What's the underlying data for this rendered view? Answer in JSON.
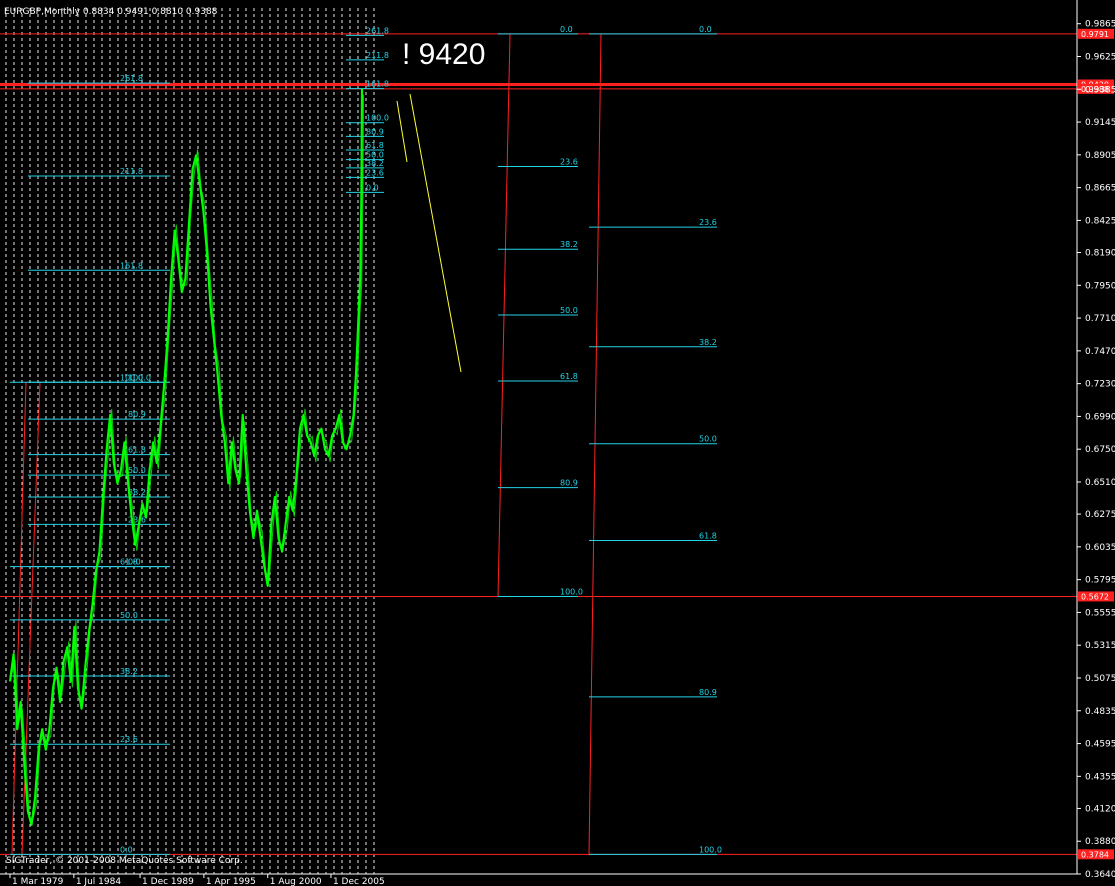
{
  "window": {
    "header": "EURGBP,Monthly  0.8834 0.9491 0.8810 0.9388",
    "copyright": "SIGTrader, © 2001-2008 MetaQuotes Software Corp.",
    "annotation": "! 9420"
  },
  "colors": {
    "background": "#000000",
    "price": "#00ff00",
    "fib": "#22d3e6",
    "level": "#ff2020",
    "trend": "#ffff33",
    "grid": "#ffffff"
  },
  "chart_data": {
    "type": "line",
    "symbol": "EURGBP",
    "timeframe": "Monthly",
    "ohlc_header": {
      "open": 0.8834,
      "high": 0.9491,
      "low": 0.881,
      "close": 0.9388
    },
    "ylim": [
      0.364,
      0.998
    ],
    "y_ticks": [
      "0.9865",
      "0.9625",
      "0.9385",
      "0.9145",
      "0.8905",
      "0.8665",
      "0.8425",
      "0.8190",
      "0.7950",
      "0.7710",
      "0.7470",
      "0.7230",
      "0.6990",
      "0.6750",
      "0.6510",
      "0.6275",
      "0.6035",
      "0.5795",
      "0.5555",
      "0.5315",
      "0.5075",
      "0.4835",
      "0.4595",
      "0.4355",
      "0.4120",
      "0.3880",
      "0.3640"
    ],
    "x_ticks": [
      "1 Mar 1979",
      "1 Jul 1984",
      "1 Dec 1989",
      "1 Apr 1995",
      "1 Aug 2000",
      "1 Dec 2005"
    ],
    "x_range_years": [
      1979.0,
      2008.5
    ],
    "price_path": [
      [
        1979.0,
        0.505
      ],
      [
        1979.3,
        0.525
      ],
      [
        1979.6,
        0.47
      ],
      [
        1979.9,
        0.49
      ],
      [
        1980.2,
        0.445
      ],
      [
        1980.5,
        0.41
      ],
      [
        1980.8,
        0.4
      ],
      [
        1981.1,
        0.42
      ],
      [
        1981.4,
        0.455
      ],
      [
        1981.7,
        0.47
      ],
      [
        1982.0,
        0.455
      ],
      [
        1982.3,
        0.47
      ],
      [
        1982.6,
        0.5
      ],
      [
        1982.9,
        0.515
      ],
      [
        1983.2,
        0.49
      ],
      [
        1983.5,
        0.52
      ],
      [
        1983.8,
        0.53
      ],
      [
        1984.1,
        0.505
      ],
      [
        1984.4,
        0.545
      ],
      [
        1984.7,
        0.5
      ],
      [
        1985.0,
        0.485
      ],
      [
        1985.3,
        0.515
      ],
      [
        1985.6,
        0.54
      ],
      [
        1985.9,
        0.56
      ],
      [
        1986.2,
        0.585
      ],
      [
        1986.5,
        0.6
      ],
      [
        1986.8,
        0.64
      ],
      [
        1987.1,
        0.675
      ],
      [
        1987.4,
        0.7
      ],
      [
        1987.7,
        0.665
      ],
      [
        1988.0,
        0.65
      ],
      [
        1988.3,
        0.66
      ],
      [
        1988.6,
        0.68
      ],
      [
        1988.9,
        0.65
      ],
      [
        1989.2,
        0.625
      ],
      [
        1989.5,
        0.605
      ],
      [
        1989.8,
        0.62
      ],
      [
        1990.1,
        0.635
      ],
      [
        1990.4,
        0.625
      ],
      [
        1990.7,
        0.66
      ],
      [
        1991.0,
        0.68
      ],
      [
        1991.3,
        0.665
      ],
      [
        1991.6,
        0.69
      ],
      [
        1991.9,
        0.72
      ],
      [
        1992.2,
        0.755
      ],
      [
        1992.5,
        0.8
      ],
      [
        1992.8,
        0.835
      ],
      [
        1993.1,
        0.815
      ],
      [
        1993.4,
        0.79
      ],
      [
        1993.7,
        0.8
      ],
      [
        1994.0,
        0.84
      ],
      [
        1994.3,
        0.88
      ],
      [
        1994.6,
        0.89
      ],
      [
        1994.9,
        0.87
      ],
      [
        1995.2,
        0.85
      ],
      [
        1995.5,
        0.82
      ],
      [
        1995.8,
        0.78
      ],
      [
        1996.1,
        0.755
      ],
      [
        1996.4,
        0.73
      ],
      [
        1996.7,
        0.7
      ],
      [
        1997.0,
        0.68
      ],
      [
        1997.3,
        0.65
      ],
      [
        1997.6,
        0.68
      ],
      [
        1997.9,
        0.66
      ],
      [
        1998.2,
        0.65
      ],
      [
        1998.5,
        0.7
      ],
      [
        1998.8,
        0.66
      ],
      [
        1999.1,
        0.63
      ],
      [
        1999.4,
        0.61
      ],
      [
        1999.7,
        0.63
      ],
      [
        2000.0,
        0.61
      ],
      [
        2000.3,
        0.59
      ],
      [
        2000.6,
        0.575
      ],
      [
        2000.9,
        0.62
      ],
      [
        2001.2,
        0.64
      ],
      [
        2001.5,
        0.61
      ],
      [
        2001.8,
        0.6
      ],
      [
        2002.1,
        0.62
      ],
      [
        2002.4,
        0.64
      ],
      [
        2002.7,
        0.63
      ],
      [
        2003.0,
        0.655
      ],
      [
        2003.3,
        0.69
      ],
      [
        2003.6,
        0.7
      ],
      [
        2003.9,
        0.685
      ],
      [
        2004.2,
        0.68
      ],
      [
        2004.5,
        0.67
      ],
      [
        2004.8,
        0.685
      ],
      [
        2005.1,
        0.69
      ],
      [
        2005.4,
        0.675
      ],
      [
        2005.7,
        0.67
      ],
      [
        2006.0,
        0.685
      ],
      [
        2006.3,
        0.69
      ],
      [
        2006.6,
        0.7
      ],
      [
        2006.9,
        0.68
      ],
      [
        2007.2,
        0.675
      ],
      [
        2007.5,
        0.685
      ],
      [
        2007.8,
        0.7
      ],
      [
        2008.0,
        0.73
      ],
      [
        2008.2,
        0.77
      ],
      [
        2008.35,
        0.8
      ],
      [
        2008.45,
        0.86
      ],
      [
        2008.5,
        0.9388
      ]
    ],
    "horizontal_levels": [
      {
        "price": 0.9791,
        "tag": "0.9791",
        "width": 1
      },
      {
        "price": 0.942,
        "tag": "0.9420",
        "width": 3
      },
      {
        "price": 0.9388,
        "tag": "0.9388",
        "width": 1
      },
      {
        "price": 0.5672,
        "tag": "0.5672",
        "width": 1
      },
      {
        "price": 0.3784,
        "tag": "0.3784",
        "width": 1
      }
    ],
    "fib_sets": [
      {
        "name": "fib-right-a",
        "levels": [
          {
            "label": "0.0",
            "price": 0.9791
          },
          {
            "label": "23.6",
            "price": 0.882
          },
          {
            "label": "38.2",
            "price": 0.8214
          },
          {
            "label": "50.0",
            "price": 0.7732
          },
          {
            "label": "61.8",
            "price": 0.7249
          },
          {
            "label": "80.9",
            "price": 0.6469
          },
          {
            "label": "100.0",
            "price": 0.5672
          }
        ]
      },
      {
        "name": "fib-right-b",
        "levels": [
          {
            "label": "0.0",
            "price": 0.9791
          },
          {
            "label": "23.6",
            "price": 0.8376
          },
          {
            "label": "38.2",
            "price": 0.75
          },
          {
            "label": "50.0",
            "price": 0.679
          },
          {
            "label": "61.8",
            "price": 0.6082
          },
          {
            "label": "80.9",
            "price": 0.4937
          },
          {
            "label": "100.0",
            "price": 0.3784
          }
        ]
      },
      {
        "name": "fib-left-large",
        "levels": [
          {
            "label": "261.8",
            "price": 0.943
          },
          {
            "label": "211.8",
            "price": 0.875
          },
          {
            "label": "161.8",
            "price": 0.806
          },
          {
            "label": "100.0",
            "price": 0.724
          },
          {
            "label": "61.8",
            "price": 0.589
          },
          {
            "label": "50.0",
            "price": 0.55
          },
          {
            "label": "38.2",
            "price": 0.509
          },
          {
            "label": "23.6",
            "price": 0.459
          },
          {
            "label": "0.0",
            "price": 0.3784
          }
        ]
      },
      {
        "name": "fib-left-small",
        "levels": [
          {
            "label": "100.0",
            "price": 0.724
          },
          {
            "label": "80.9",
            "price": 0.697
          },
          {
            "label": "61.8",
            "price": 0.671
          },
          {
            "label": "50.0",
            "price": 0.656
          },
          {
            "label": "38.2",
            "price": 0.64
          },
          {
            "label": "23.6",
            "price": 0.62
          },
          {
            "label": "0.0",
            "price": 0.589
          }
        ]
      },
      {
        "name": "fib-top-right",
        "levels": [
          {
            "label": "261.8",
            "price": 0.978
          },
          {
            "label": "211.8",
            "price": 0.96
          },
          {
            "label": "161.8",
            "price": 0.939
          },
          {
            "label": "100.0",
            "price": 0.914
          },
          {
            "label": "80.9",
            "price": 0.904
          },
          {
            "label": "61.8",
            "price": 0.894
          },
          {
            "label": "50.0",
            "price": 0.887
          },
          {
            "label": "38.2",
            "price": 0.881
          },
          {
            "label": "23.6",
            "price": 0.874
          },
          {
            "label": "0.0",
            "price": 0.863
          }
        ]
      }
    ]
  }
}
